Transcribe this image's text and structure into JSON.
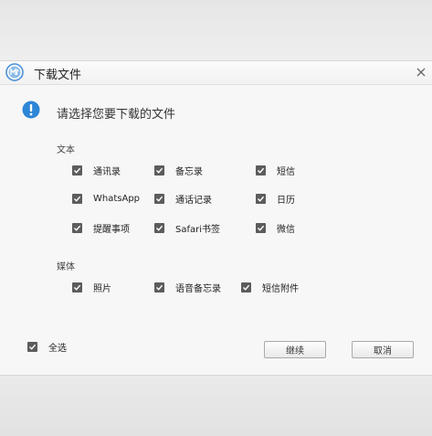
{
  "window": {
    "title": "下载文件",
    "app_icon": "app-logo-icon",
    "close_icon": "close-icon"
  },
  "info": {
    "icon": "info-icon",
    "prompt": "请选择您要下载的文件"
  },
  "sections": {
    "text": {
      "label": "文本",
      "items": [
        {
          "label": "通讯录",
          "checked": true
        },
        {
          "label": "备忘录",
          "checked": true
        },
        {
          "label": "短信",
          "checked": true
        },
        {
          "label": "WhatsApp",
          "checked": true
        },
        {
          "label": "通话记录",
          "checked": true
        },
        {
          "label": "日历",
          "checked": true
        },
        {
          "label": "提醒事项",
          "checked": true
        },
        {
          "label": "Safari书签",
          "checked": true
        },
        {
          "label": "微信",
          "checked": true
        }
      ]
    },
    "media": {
      "label": "媒体",
      "items": [
        {
          "label": "照片",
          "checked": true
        },
        {
          "label": "语音备忘录",
          "checked": true
        },
        {
          "label": "短信附件",
          "checked": true
        }
      ]
    }
  },
  "footer": {
    "select_all_label": "全选",
    "select_all_checked": true,
    "continue_label": "继续",
    "cancel_label": "取消"
  },
  "colors": {
    "info_blue": "#2e86d6",
    "checkbox_fill": "#5c5c5c",
    "dialog_bg": "#f7f7f7"
  }
}
